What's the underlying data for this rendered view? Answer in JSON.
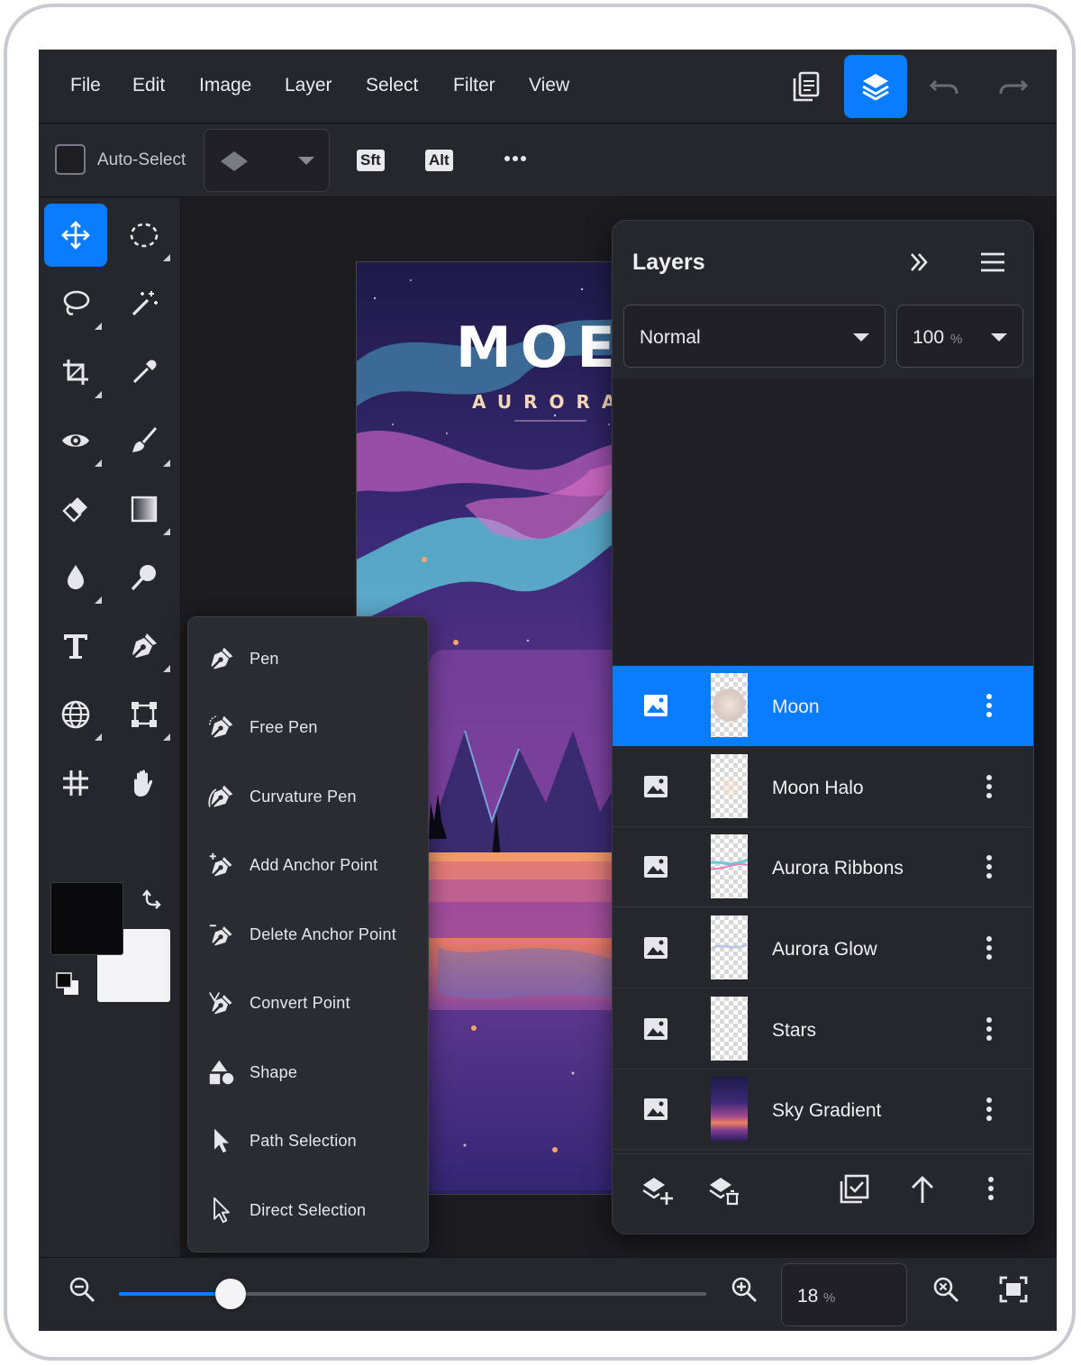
{
  "menubar": {
    "items": [
      "File",
      "Edit",
      "Image",
      "Layer",
      "Select",
      "Filter",
      "View"
    ]
  },
  "options": {
    "auto_select_label": "Auto-Select",
    "auto_select_checked": false,
    "modifier_keys": [
      "Sft",
      "Alt"
    ]
  },
  "artwork": {
    "title_partial": "MOE",
    "subtitle_partial": "AURORA"
  },
  "flyout": {
    "items": [
      {
        "label": "Pen",
        "icon": "pen-icon"
      },
      {
        "label": "Free Pen",
        "icon": "free-pen-icon"
      },
      {
        "label": "Curvature Pen",
        "icon": "curvature-pen-icon"
      },
      {
        "label": "Add Anchor Point",
        "icon": "add-anchor-icon"
      },
      {
        "label": "Delete Anchor Point",
        "icon": "delete-anchor-icon"
      },
      {
        "label": "Convert Point",
        "icon": "convert-point-icon"
      },
      {
        "label": "Shape",
        "icon": "shape-icon"
      },
      {
        "label": "Path Selection",
        "icon": "path-selection-icon"
      },
      {
        "label": "Direct Selection",
        "icon": "direct-selection-icon"
      }
    ]
  },
  "layers_panel": {
    "title": "Layers",
    "blend_mode": "Normal",
    "opacity_value": "100",
    "opacity_unit": "%",
    "selected_layer": "Moon",
    "layers": [
      {
        "name": "Moon",
        "selected": true
      },
      {
        "name": "Moon Halo",
        "selected": false
      },
      {
        "name": "Aurora Ribbons",
        "selected": false
      },
      {
        "name": "Aurora Glow",
        "selected": false
      },
      {
        "name": "Stars",
        "selected": false
      },
      {
        "name": "Sky Gradient",
        "selected": false
      }
    ]
  },
  "colors": {
    "accent": "#0a7cff",
    "foreground": "#0a0a0c",
    "background": "#f4f4f6"
  },
  "zoom": {
    "value": "18",
    "unit": "%",
    "slider_fraction": 0.19
  }
}
